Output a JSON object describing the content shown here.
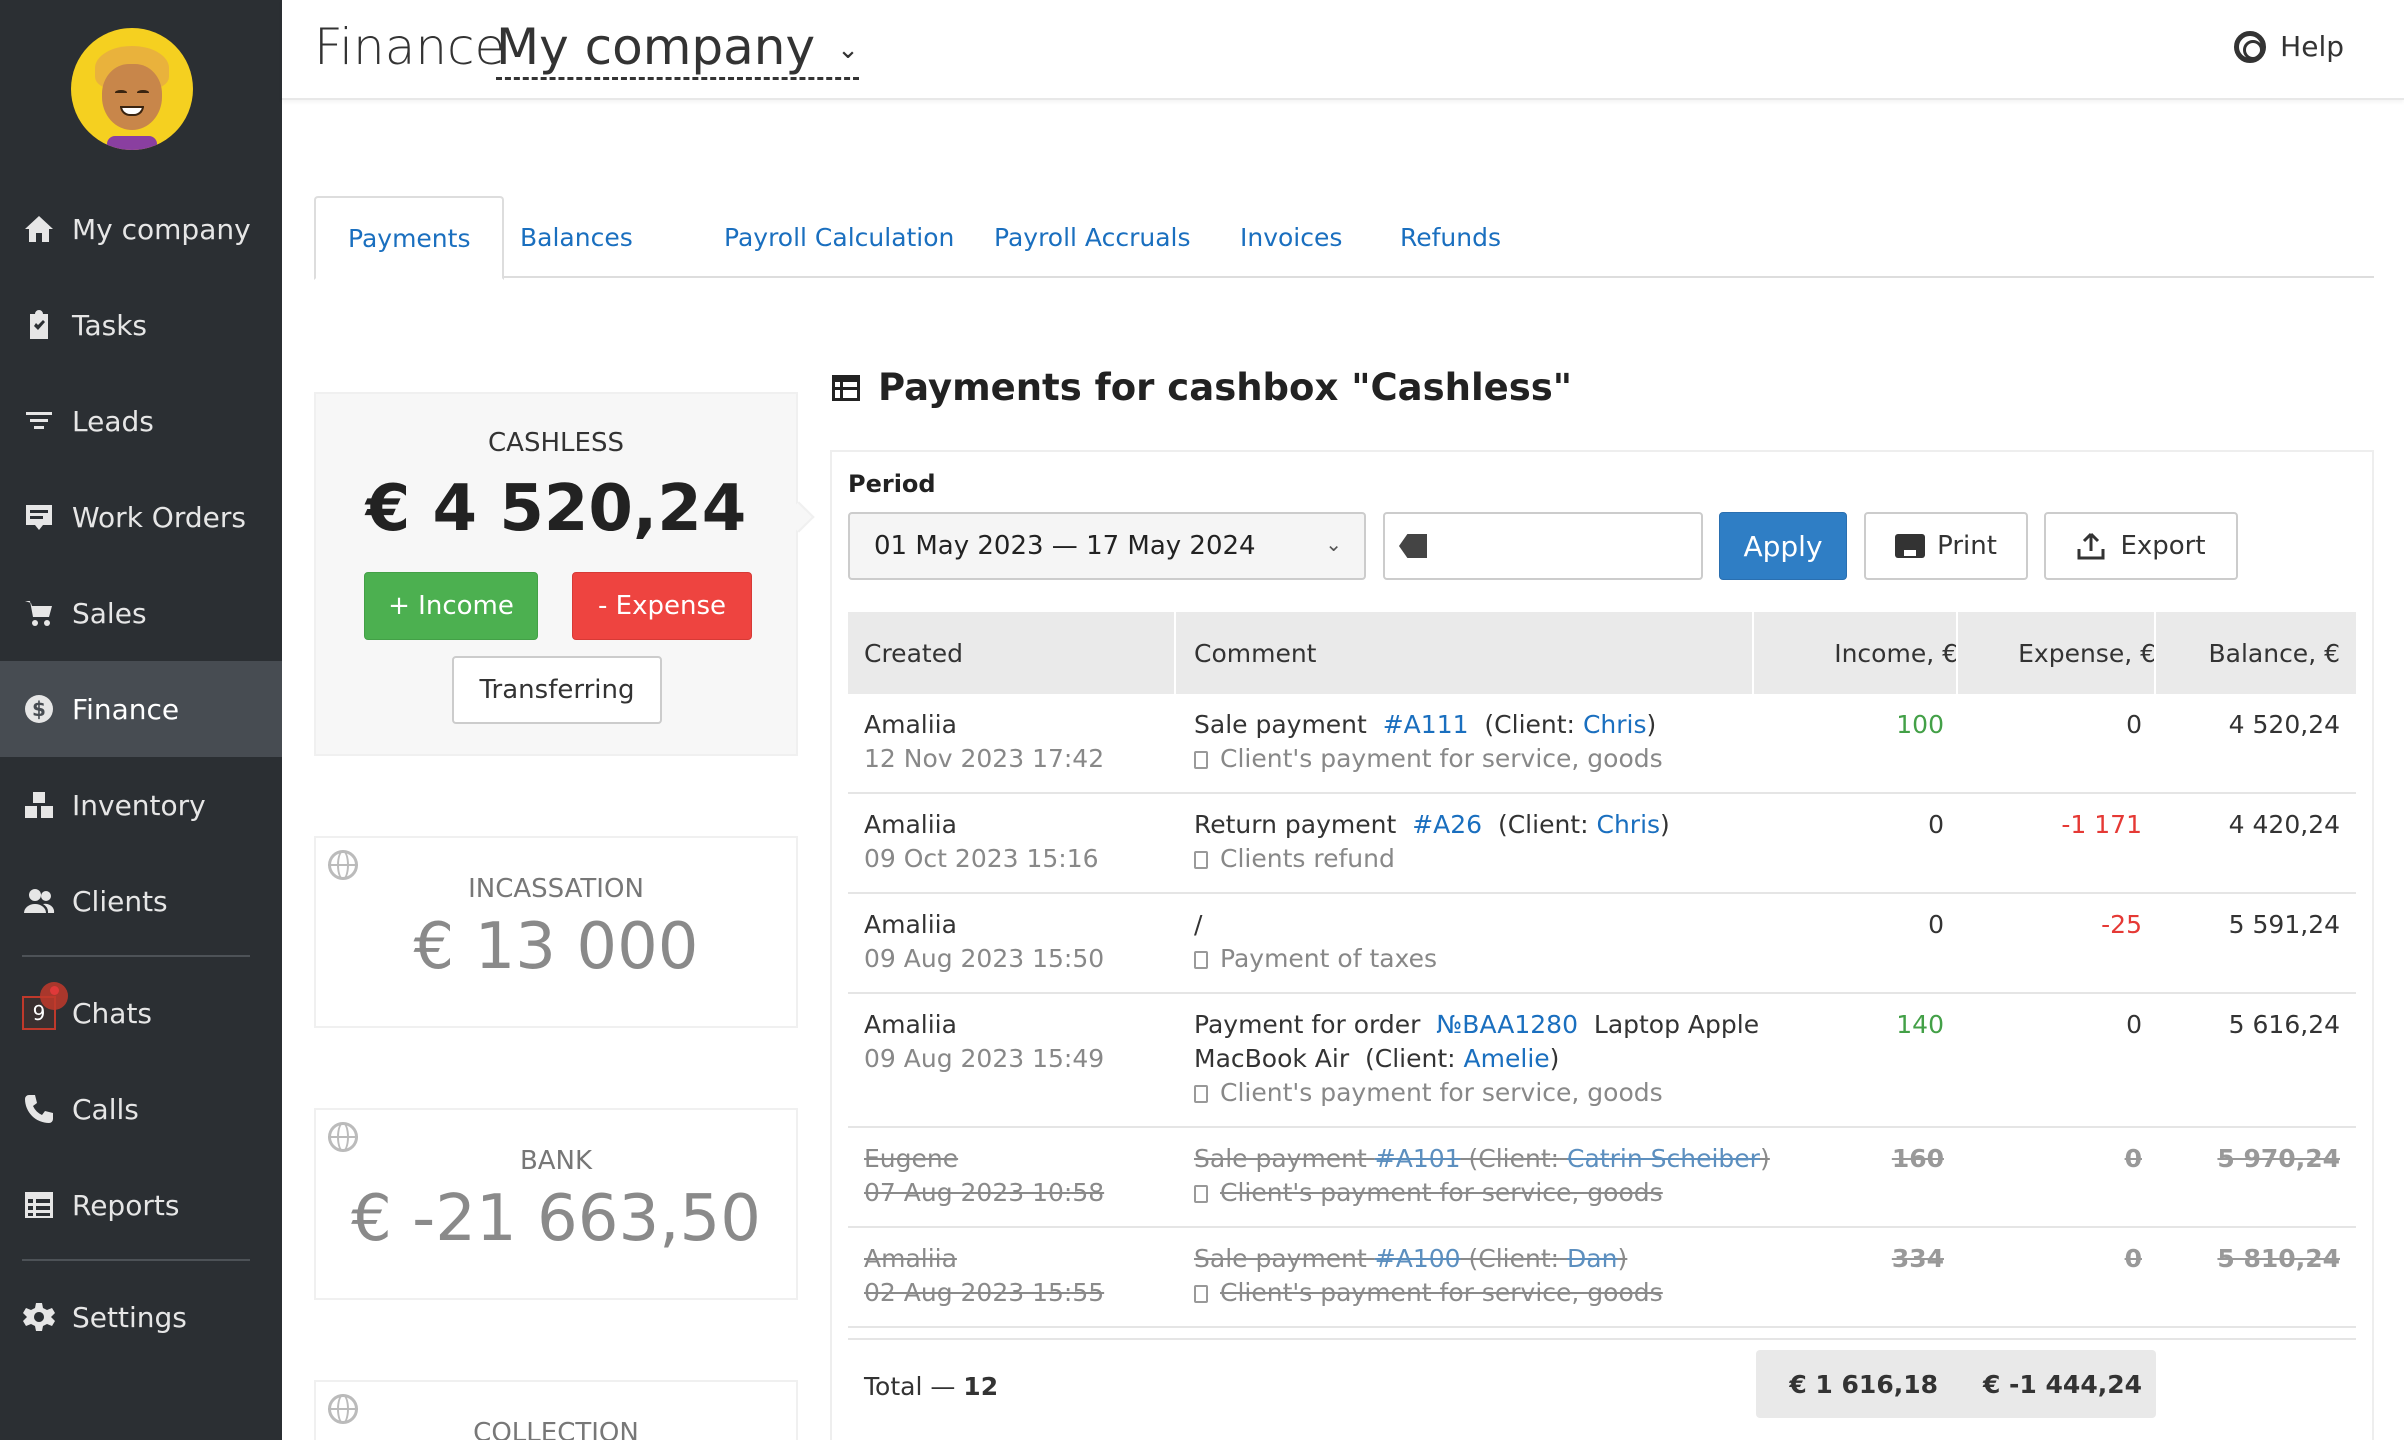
{
  "sidebar": {
    "items": [
      {
        "label": "My company",
        "icon": "home-icon"
      },
      {
        "label": "Tasks",
        "icon": "clipboard-icon"
      },
      {
        "label": "Leads",
        "icon": "filter-icon"
      },
      {
        "label": "Work Orders",
        "icon": "work-order-icon"
      },
      {
        "label": "Sales",
        "icon": "cart-icon"
      },
      {
        "label": "Finance",
        "icon": "dollar-icon"
      },
      {
        "label": "Inventory",
        "icon": "boxes-icon"
      },
      {
        "label": "Clients",
        "icon": "users-icon"
      },
      {
        "label": "Chats",
        "icon": "chat-icon",
        "badge": "9"
      },
      {
        "label": "Calls",
        "icon": "phone-icon"
      },
      {
        "label": "Reports",
        "icon": "reports-icon"
      },
      {
        "label": "Settings",
        "icon": "gear-icon"
      }
    ],
    "active": "Finance"
  },
  "header": {
    "title": "Finance",
    "company": "My company",
    "help": "Help"
  },
  "tabs": [
    "Payments",
    "Balances",
    "Payroll Calculation",
    "Payroll Accruals",
    "Invoices",
    "Refunds"
  ],
  "cashboxes": [
    {
      "name": "CASHLESS",
      "amount": "€ 4 520,24",
      "income_label": "+ Income",
      "expense_label": "- Expense",
      "transfer_label": "Transferring"
    },
    {
      "name": "INCASSATION",
      "amount": "€ 13 000"
    },
    {
      "name": "BANK",
      "amount": "€ -21 663,50"
    },
    {
      "name": "COLLECTION",
      "amount": ""
    }
  ],
  "panel": {
    "title": "Payments for cashbox \"Cashless\"",
    "period_label": "Period",
    "period_value": "01 May 2023 — 17 May 2024",
    "apply": "Apply",
    "print": "Print",
    "export": "Export"
  },
  "table": {
    "columns": [
      "Created",
      "Comment",
      "Income, €",
      "Expense, €",
      "Balance, €"
    ],
    "rows": [
      {
        "author": "Amaliia",
        "date": "12 Nov 2023 17:42",
        "pre": "Sale payment",
        "ref": "#A111",
        "client_pre": "(Client:",
        "client": "Chris",
        "client_post": ")",
        "extra": "",
        "note": "Client's payment for service, goods",
        "income": "100",
        "expense": "0",
        "balance": "4 520,24"
      },
      {
        "author": "Amaliia",
        "date": "09 Oct 2023 15:16",
        "pre": "Return payment",
        "ref": "#A26",
        "client_pre": "(Client:",
        "client": "Chris",
        "client_post": ")",
        "extra": "",
        "note": "Clients refund",
        "income": "0",
        "expense": "-1 171",
        "balance": "4 420,24"
      },
      {
        "author": "Amaliia",
        "date": "09 Aug 2023 15:50",
        "pre": "/",
        "ref": "",
        "client_pre": "",
        "client": "",
        "client_post": "",
        "extra": "",
        "note": "Payment of taxes",
        "income": "0",
        "expense": "-25",
        "balance": "5 591,24"
      },
      {
        "author": "Amaliia",
        "date": "09 Aug 2023 15:49",
        "pre": "Payment for order",
        "ref": "№BAA1280",
        "client_pre": "",
        "client": "",
        "client_post": "",
        "extra": "Laptop Apple",
        "line2_pre": "MacBook Air  (Client:",
        "line2_client": "Amelie",
        "line2_post": ")",
        "note": "Client's payment for service, goods",
        "income": "140",
        "expense": "0",
        "balance": "5 616,24"
      },
      {
        "author": "Eugene",
        "date": "07 Aug 2023 10:58",
        "pre": "Sale payment",
        "ref": "#A101",
        "client_pre": "(Client:",
        "client": "Catrin Scheiber",
        "client_post": ")",
        "extra": "",
        "note": "Client's payment for service, goods",
        "income": "160",
        "expense": "0",
        "balance": "5 970,24",
        "cancelled": true
      },
      {
        "author": "Amaliia",
        "date": "02 Aug 2023 15:55",
        "pre": "Sale payment",
        "ref": "#A100",
        "client_pre": "(Client:",
        "client": "Dan",
        "client_post": ")",
        "extra": "",
        "note": "Client's payment for service, goods",
        "income": "334",
        "expense": "0",
        "balance": "5 810,24",
        "cancelled": true
      }
    ],
    "total_label": "Total —",
    "total_count": "12",
    "total_income": "€ 1 616,18",
    "total_expense": "€ -1 444,24"
  },
  "colors": {
    "sidebar_bg": "#2b2f33",
    "sidebar_active": "#474c52",
    "link": "#1a6fbf",
    "income_green": "#4cb050",
    "expense_red": "#ee4440",
    "apply_blue": "#2f7ec5"
  }
}
